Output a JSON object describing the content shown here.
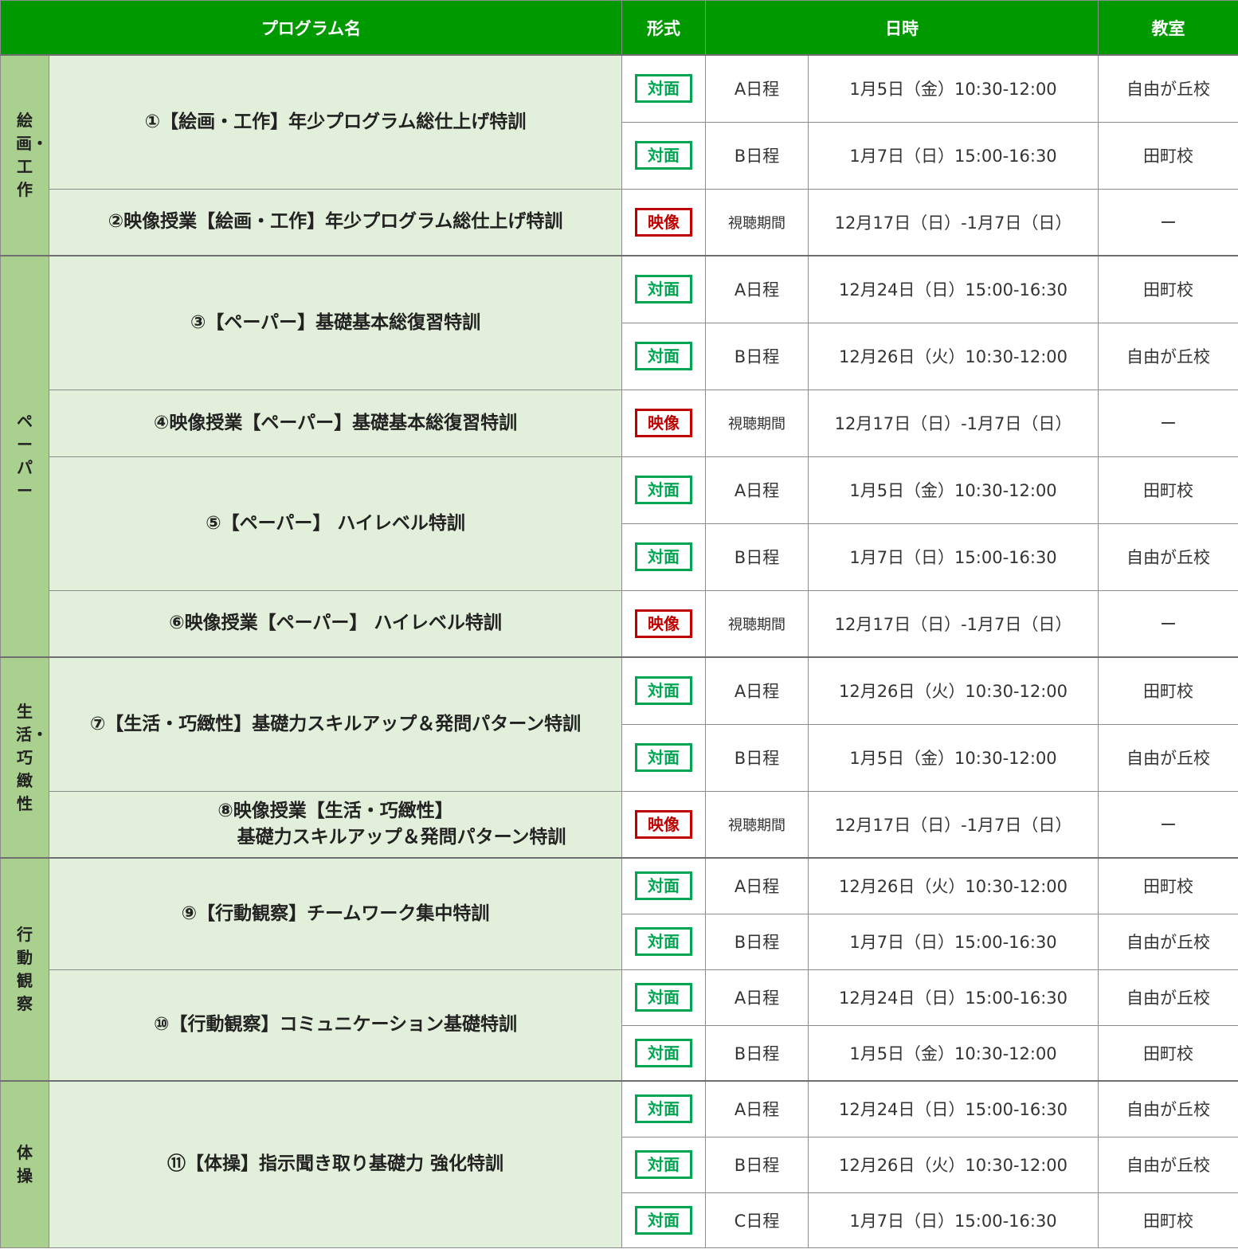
{
  "header": {
    "program": "プログラム名",
    "format": "形式",
    "datetime": "日時",
    "room": "教室"
  },
  "categories": [
    {
      "label": "絵画・工作"
    },
    {
      "label": "ペーパー"
    },
    {
      "label": "生活・巧緻性"
    },
    {
      "label": "行動観察"
    },
    {
      "label": "体操"
    }
  ],
  "programs": [
    {
      "name": "①【絵画・工作】年少プログラム総仕上げ特訓",
      "rows": [
        {
          "format": "対面",
          "session": "A日程",
          "date": "1月5日（金）10:30-12:00",
          "room": "自由が丘校"
        },
        {
          "format": "対面",
          "session": "B日程",
          "date": "1月7日（日）15:00-16:30",
          "room": "田町校"
        }
      ]
    },
    {
      "name": "②映像授業【絵画・工作】年少プログラム総仕上げ特訓",
      "rows": [
        {
          "format": "映像",
          "session": "視聴期間",
          "date": "12月17日（日）-1月7日（日）",
          "room": "ー"
        }
      ]
    },
    {
      "name": "③【ペーパー】基礎基本総復習特訓",
      "rows": [
        {
          "format": "対面",
          "session": "A日程",
          "date": "12月24日（日）15:00-16:30",
          "room": "田町校"
        },
        {
          "format": "対面",
          "session": "B日程",
          "date": "12月26日（火）10:30-12:00",
          "room": "自由が丘校"
        }
      ]
    },
    {
      "name": "④映像授業【ペーパー】基礎基本総復習特訓",
      "rows": [
        {
          "format": "映像",
          "session": "視聴期間",
          "date": "12月17日（日）-1月7日（日）",
          "room": "ー"
        }
      ]
    },
    {
      "name": "⑤【ペーパー】 ハイレベル特訓",
      "rows": [
        {
          "format": "対面",
          "session": "A日程",
          "date": "1月5日（金）10:30-12:00",
          "room": "田町校"
        },
        {
          "format": "対面",
          "session": "B日程",
          "date": "1月7日（日）15:00-16:30",
          "room": "自由が丘校"
        }
      ]
    },
    {
      "name": "⑥映像授業【ペーパー】 ハイレベル特訓",
      "rows": [
        {
          "format": "映像",
          "session": "視聴期間",
          "date": "12月17日（日）-1月7日（日）",
          "room": "ー"
        }
      ]
    },
    {
      "name": "⑦【生活・巧緻性】基礎力スキルアップ＆発問パターン特訓",
      "rows": [
        {
          "format": "対面",
          "session": "A日程",
          "date": "12月26日（火）10:30-12:00",
          "room": "田町校"
        },
        {
          "format": "対面",
          "session": "B日程",
          "date": "1月5日（金）10:30-12:00",
          "room": "自由が丘校"
        }
      ]
    },
    {
      "name": "⑧映像授業【生活・巧緻性】",
      "name_line2": "基礎力スキルアップ＆発問パターン特訓",
      "rows": [
        {
          "format": "映像",
          "session": "視聴期間",
          "date": "12月17日（日）-1月7日（日）",
          "room": "ー"
        }
      ]
    },
    {
      "name": "⑨【行動観察】チームワーク集中特訓",
      "rows": [
        {
          "format": "対面",
          "session": "A日程",
          "date": "12月26日（火）10:30-12:00",
          "room": "田町校"
        },
        {
          "format": "対面",
          "session": "B日程",
          "date": "1月7日（日）15:00-16:30",
          "room": "自由が丘校"
        }
      ]
    },
    {
      "name": "⑩【行動観察】コミュニケーション基礎特訓",
      "rows": [
        {
          "format": "対面",
          "session": "A日程",
          "date": "12月24日（日）15:00-16:30",
          "room": "自由が丘校"
        },
        {
          "format": "対面",
          "session": "B日程",
          "date": "1月5日（金）10:30-12:00",
          "room": "田町校"
        }
      ]
    },
    {
      "name": "⑪【体操】指示聞き取り基礎力 強化特訓",
      "rows": [
        {
          "format": "対面",
          "session": "A日程",
          "date": "12月24日（日）15:00-16:30",
          "room": "自由が丘校"
        },
        {
          "format": "対面",
          "session": "B日程",
          "date": "12月26日（火）10:30-12:00",
          "room": "自由が丘校"
        },
        {
          "format": "対面",
          "session": "C日程",
          "date": "1月7日（日）15:00-16:30",
          "room": "田町校"
        }
      ]
    }
  ],
  "colors": {
    "header_bg": "#009a00",
    "category_bg": "#a9d08e",
    "program_bg": "#e2efda",
    "face_to_face": "#00a651",
    "video": "#c00000"
  }
}
